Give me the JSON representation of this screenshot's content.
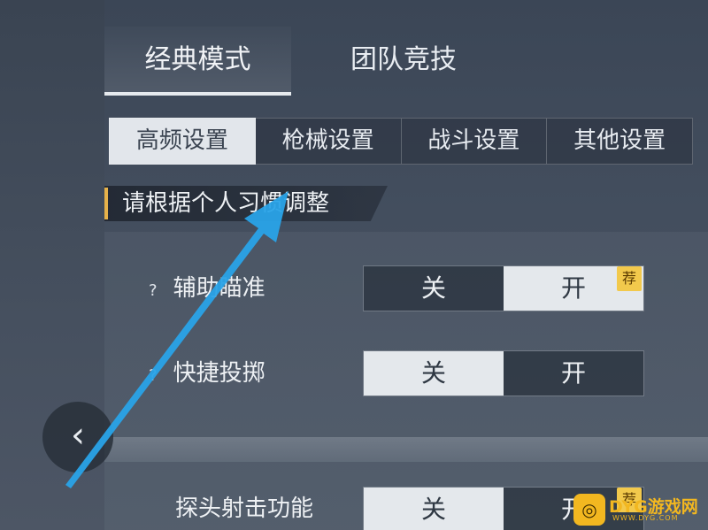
{
  "mode_tabs": [
    {
      "label": "经典模式",
      "active": true
    },
    {
      "label": "团队竞技",
      "active": false
    }
  ],
  "sub_tabs": [
    {
      "label": "高频设置",
      "active": true
    },
    {
      "label": "枪械设置",
      "active": false
    },
    {
      "label": "战斗设置",
      "active": false
    },
    {
      "label": "其他设置",
      "active": false
    }
  ],
  "hint": "请根据个人习惯调整",
  "settings": [
    {
      "help": "?",
      "label": "辅助瞄准",
      "off": "关",
      "on": "开",
      "selected": "on",
      "badge": "荐"
    },
    {
      "help": "?",
      "label": "快捷投掷",
      "off": "关",
      "on": "开",
      "selected": "off"
    },
    {
      "label": "探头射击功能",
      "off": "关",
      "on": "开",
      "selected": "off",
      "badge": "荐"
    }
  ],
  "back_button": {
    "glyph": "‹"
  },
  "watermark": {
    "logo_glyph": "◎",
    "brand": "DYG游戏网",
    "domain": "WWW.DYG.COM"
  },
  "colors": {
    "accent_bar": "#e7b24a",
    "badge": "#f2c94c",
    "arrow": "#29a3e8",
    "watermark": "#f2b720"
  }
}
